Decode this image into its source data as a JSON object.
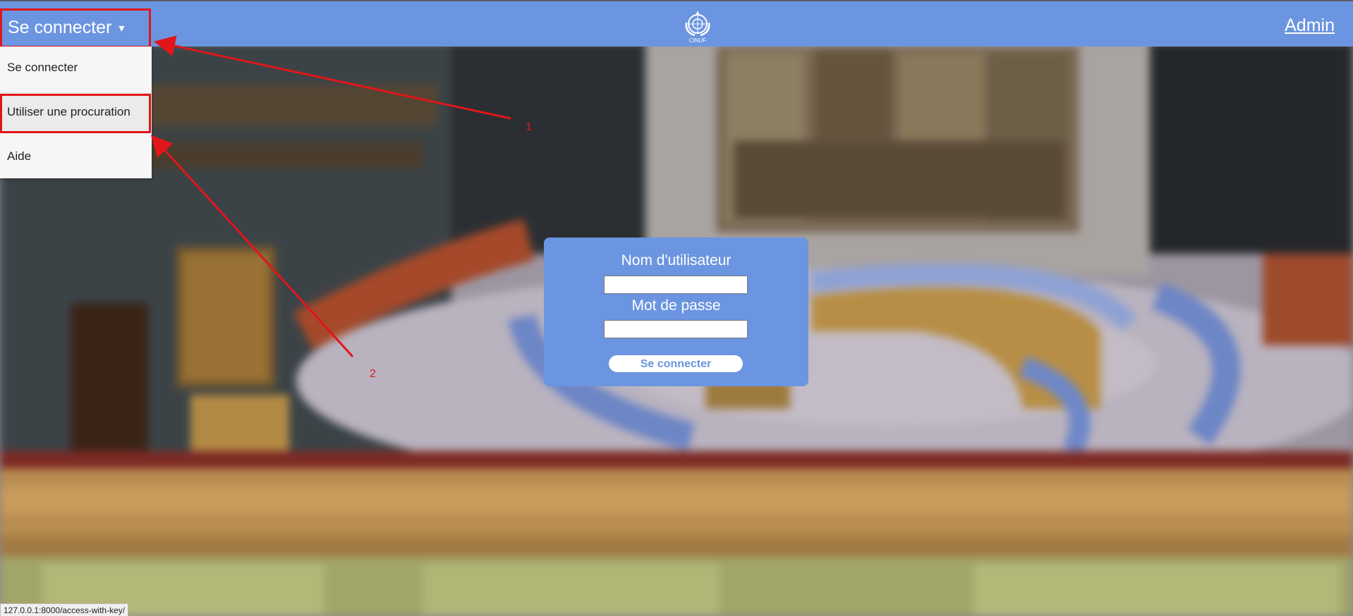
{
  "topbar": {
    "menu_label": "Se connecter",
    "menu_caret": "▾",
    "admin_label": "Admin",
    "logo_caption": "CINUF",
    "color": "#6b95e0"
  },
  "dropdown": {
    "items": [
      {
        "label": "Se connecter"
      },
      {
        "label": "Utiliser une procuration"
      },
      {
        "label": "Aide"
      }
    ]
  },
  "login": {
    "username_label": "Nom d'utilisateur",
    "password_label": "Mot de passe",
    "username_value": "",
    "password_value": "",
    "submit_label": "Se connecter"
  },
  "annotations": {
    "label_1": "1",
    "label_2": "2",
    "color": "#e0161b"
  },
  "statusbar": {
    "url": "127.0.0.1:8000/access-with-key/"
  }
}
